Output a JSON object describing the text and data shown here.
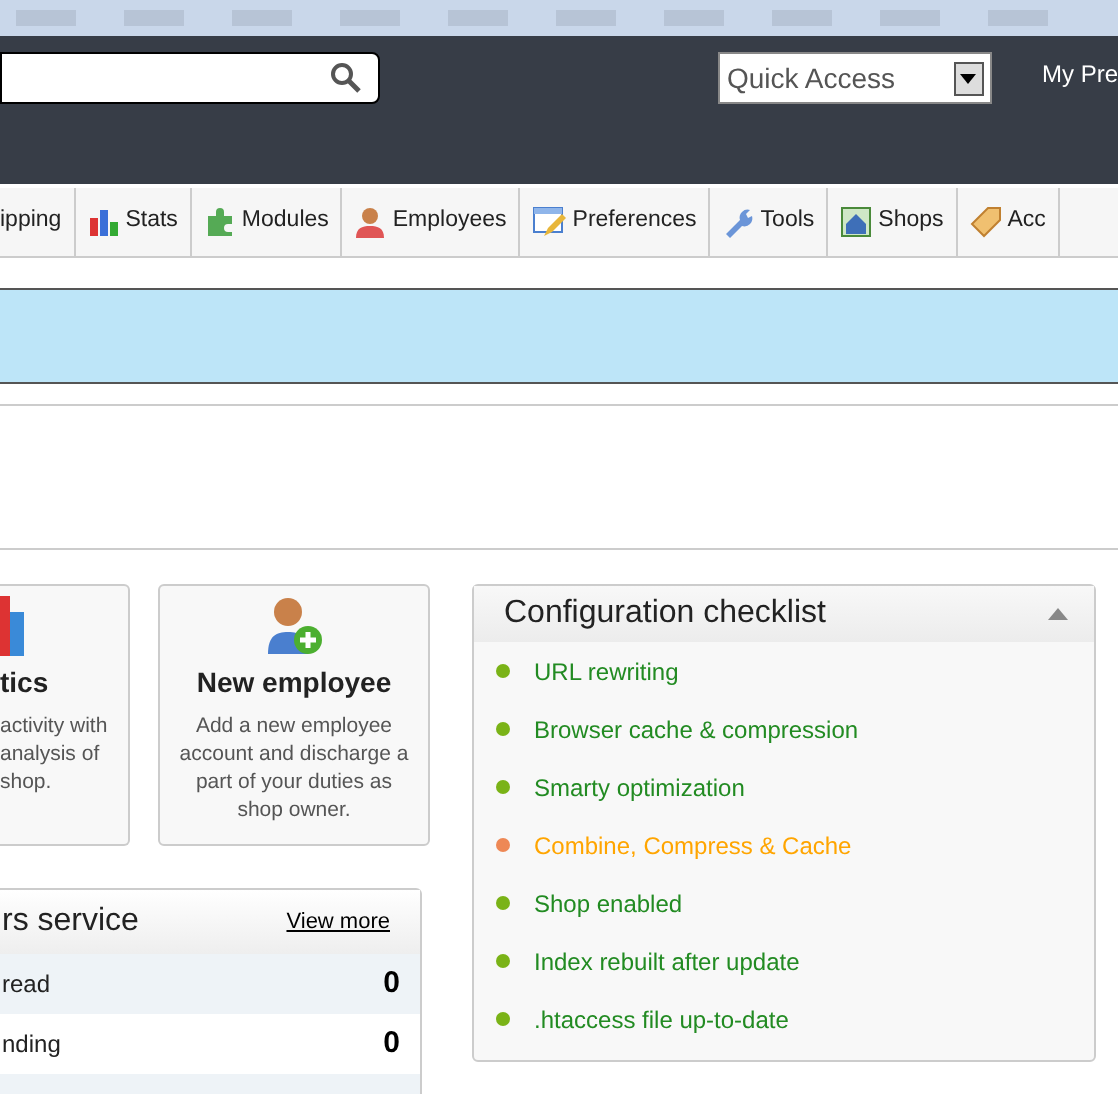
{
  "header": {
    "quick_access": {
      "value": "Quick Access"
    },
    "profile_link": "My Pre"
  },
  "tabs": [
    {
      "label": "ipping",
      "kind": "plain",
      "selected": false
    },
    {
      "label": "Stats",
      "kind": "chart",
      "selected": false
    },
    {
      "label": "Modules",
      "kind": "puzzle",
      "selected": false
    },
    {
      "label": "Employees",
      "kind": "person",
      "selected": false
    },
    {
      "label": "Preferences",
      "kind": "pencil",
      "selected": false
    },
    {
      "label": "Tools",
      "kind": "wrench",
      "selected": false
    },
    {
      "label": "Shops",
      "kind": "house",
      "selected": false
    },
    {
      "label": "Acc",
      "kind": "tag",
      "selected": false
    }
  ],
  "cards": [
    {
      "title": "tics",
      "description": "activity with analysis of shop.",
      "kind": "chart"
    },
    {
      "title": "New employee",
      "description": "Add a new employee account and discharge a part of your duties as shop owner.",
      "kind": "person-add"
    }
  ],
  "customer_service": {
    "title": "rs service",
    "link": "View more",
    "rows": [
      {
        "label": "read",
        "value": "0"
      },
      {
        "label": "nding",
        "value": "0"
      }
    ]
  },
  "checklist": {
    "title": "Configuration checklist",
    "expanded": true,
    "items": [
      {
        "label": "URL rewriting",
        "kind": "ok"
      },
      {
        "label": "Browser cache & compression",
        "kind": "ok"
      },
      {
        "label": "Smarty optimization",
        "kind": "ok"
      },
      {
        "label": "Combine, Compress & Cache",
        "kind": "warning"
      },
      {
        "label": "Shop enabled",
        "kind": "ok"
      },
      {
        "label": "Index rebuilt after update",
        "kind": "ok"
      },
      {
        "label": ".htaccess file up-to-date",
        "kind": "ok"
      }
    ]
  }
}
